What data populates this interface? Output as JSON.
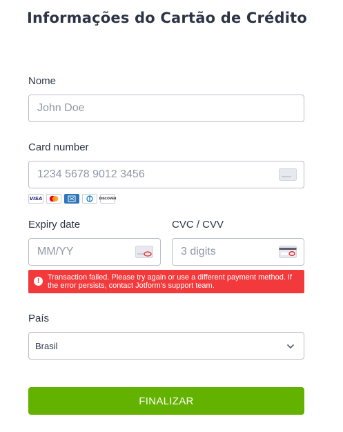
{
  "form": {
    "title": "Informações do Cartão de Crédito"
  },
  "name": {
    "label": "Nome",
    "placeholder": "John Doe"
  },
  "card_number": {
    "label": "Card number",
    "placeholder": "1234 5678 9012 3456",
    "brands": [
      "VISA",
      "DISCOVER"
    ]
  },
  "expiry": {
    "label": "Expiry date",
    "placeholder": "MM/YY"
  },
  "cvc": {
    "label": "CVC / CVV",
    "placeholder": "3 digits"
  },
  "error": {
    "icon": "!",
    "message": "Transaction failed. Please try again or use a different payment method. If the error persists, contact Jotform's support team."
  },
  "country": {
    "label": "País",
    "selected": "Brasil"
  },
  "submit": {
    "label": "FINALIZAR"
  },
  "colors": {
    "accent_green": "#64b200",
    "error_red": "#f23a3c",
    "text_dark": "#2c3345",
    "border": "#b8bdc9"
  }
}
